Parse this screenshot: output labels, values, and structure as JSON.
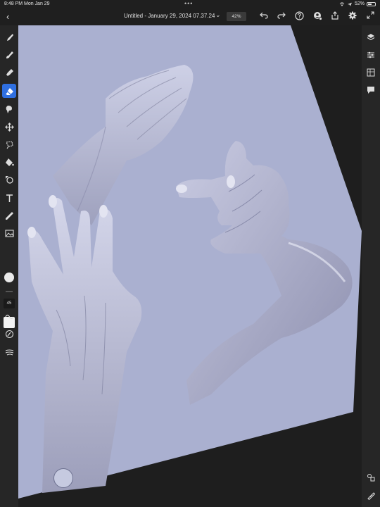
{
  "status": {
    "time": "8:48 PM",
    "date": "Mon Jan 29",
    "dots": "•••",
    "battery": "52%",
    "battery_level": 0.52
  },
  "header": {
    "title": "Untitled - January 29, 2024 07.37.24",
    "zoom": "42%"
  },
  "left_toolbar": {
    "brush_size": "45",
    "active_tool": "eraser",
    "color": "#eaeaea"
  },
  "colors": {
    "canvas": "#aab0d0",
    "accent": "#2f6fe0",
    "chrome": "#262626"
  }
}
